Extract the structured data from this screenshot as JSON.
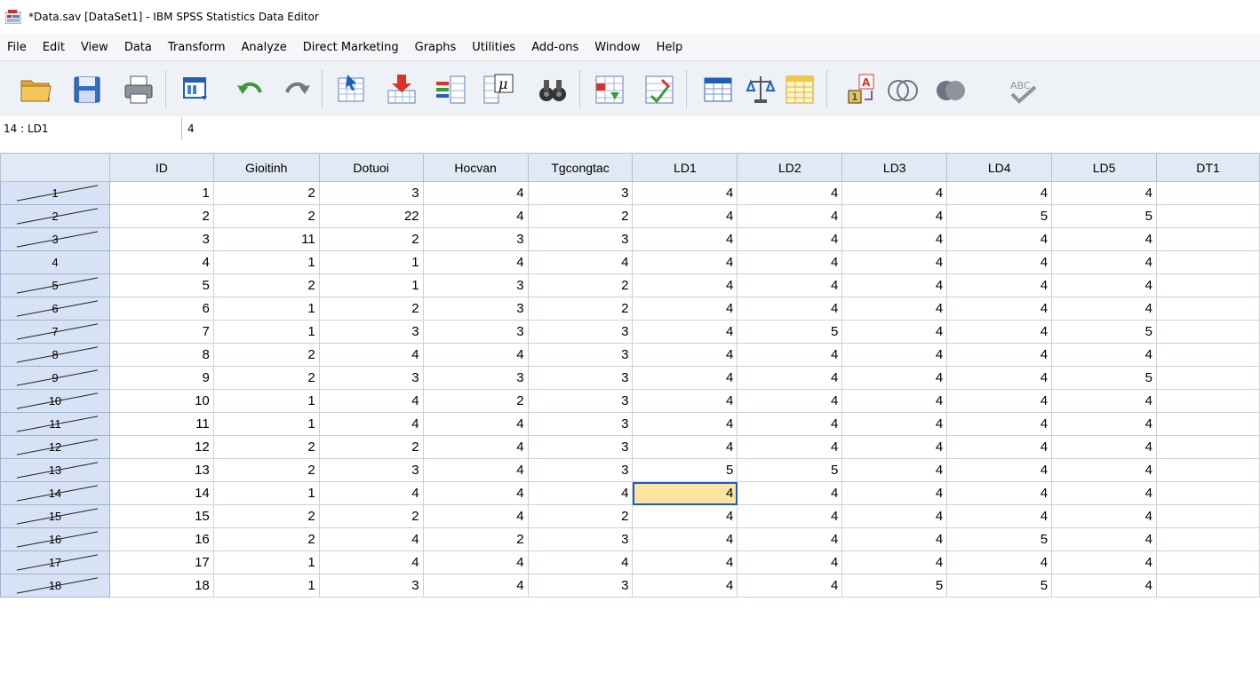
{
  "window": {
    "title": "*Data.sav [DataSet1] - IBM SPSS Statistics Data Editor"
  },
  "menu": [
    "File",
    "Edit",
    "View",
    "Data",
    "Transform",
    "Analyze",
    "Direct Marketing",
    "Graphs",
    "Utilities",
    "Add-ons",
    "Window",
    "Help"
  ],
  "toolbar": {
    "icons": [
      "open-folder-icon",
      "save-icon",
      "print-icon",
      "dialog-recall-icon",
      "undo-icon",
      "redo-icon",
      "go-to-case-icon",
      "go-to-variable-icon",
      "variables-icon",
      "descriptive-statistics-icon",
      "find-icon",
      "insert-cases-icon",
      "insert-variable-icon",
      "split-file-icon",
      "weight-cases-icon",
      "select-cases-icon",
      "value-labels-icon",
      "use-variable-sets-icon",
      "show-all-variables-icon",
      "spell-check-icon"
    ],
    "colors": {
      "accent_blue": "#1f5fb4",
      "accent_yellow": "#f4c542",
      "accent_red": "#d8342c",
      "accent_green": "#3a9a3a"
    }
  },
  "cellbar": {
    "reference": "14 : LD1",
    "value": "4"
  },
  "grid": {
    "columns": [
      "ID",
      "Gioitinh",
      "Dotuoi",
      "Hocvan",
      "Tgcongtac",
      "LD1",
      "LD2",
      "LD3",
      "LD4",
      "LD5",
      "DT1"
    ],
    "selected_row": 14,
    "selected_col": "LD1",
    "rows": [
      {
        "n": "1",
        "cells": [
          "1",
          "2",
          "3",
          "4",
          "3",
          "4",
          "4",
          "4",
          "4",
          "4",
          ""
        ]
      },
      {
        "n": "2",
        "cells": [
          "2",
          "2",
          "22",
          "4",
          "2",
          "4",
          "4",
          "4",
          "5",
          "5",
          ""
        ]
      },
      {
        "n": "3",
        "cells": [
          "3",
          "11",
          "2",
          "3",
          "3",
          "4",
          "4",
          "4",
          "4",
          "4",
          ""
        ]
      },
      {
        "n": "4",
        "cells": [
          "4",
          "1",
          "1",
          "4",
          "4",
          "4",
          "4",
          "4",
          "4",
          "4",
          ""
        ]
      },
      {
        "n": "5",
        "cells": [
          "5",
          "2",
          "1",
          "3",
          "2",
          "4",
          "4",
          "4",
          "4",
          "4",
          ""
        ]
      },
      {
        "n": "6",
        "cells": [
          "6",
          "1",
          "2",
          "3",
          "2",
          "4",
          "4",
          "4",
          "4",
          "4",
          ""
        ]
      },
      {
        "n": "7",
        "cells": [
          "7",
          "1",
          "3",
          "3",
          "3",
          "4",
          "5",
          "4",
          "4",
          "5",
          ""
        ]
      },
      {
        "n": "8",
        "cells": [
          "8",
          "2",
          "4",
          "4",
          "3",
          "4",
          "4",
          "4",
          "4",
          "4",
          ""
        ]
      },
      {
        "n": "9",
        "cells": [
          "9",
          "2",
          "3",
          "3",
          "3",
          "4",
          "4",
          "4",
          "4",
          "5",
          ""
        ]
      },
      {
        "n": "10",
        "cells": [
          "10",
          "1",
          "4",
          "2",
          "3",
          "4",
          "4",
          "4",
          "4",
          "4",
          ""
        ]
      },
      {
        "n": "11",
        "cells": [
          "11",
          "1",
          "4",
          "4",
          "3",
          "4",
          "4",
          "4",
          "4",
          "4",
          ""
        ]
      },
      {
        "n": "12",
        "cells": [
          "12",
          "2",
          "2",
          "4",
          "3",
          "4",
          "4",
          "4",
          "4",
          "4",
          ""
        ]
      },
      {
        "n": "13",
        "cells": [
          "13",
          "2",
          "3",
          "4",
          "3",
          "5",
          "5",
          "4",
          "4",
          "4",
          ""
        ]
      },
      {
        "n": "14",
        "cells": [
          "14",
          "1",
          "4",
          "4",
          "4",
          "4",
          "4",
          "4",
          "4",
          "4",
          ""
        ]
      },
      {
        "n": "15",
        "cells": [
          "15",
          "2",
          "2",
          "4",
          "2",
          "4",
          "4",
          "4",
          "4",
          "4",
          ""
        ]
      },
      {
        "n": "16",
        "cells": [
          "16",
          "2",
          "4",
          "2",
          "3",
          "4",
          "4",
          "4",
          "5",
          "4",
          ""
        ]
      },
      {
        "n": "17",
        "cells": [
          "17",
          "1",
          "4",
          "4",
          "4",
          "4",
          "4",
          "4",
          "4",
          "4",
          ""
        ]
      },
      {
        "n": "18",
        "cells": [
          "18",
          "1",
          "3",
          "4",
          "3",
          "4",
          "4",
          "5",
          "5",
          "4",
          ""
        ]
      }
    ]
  }
}
